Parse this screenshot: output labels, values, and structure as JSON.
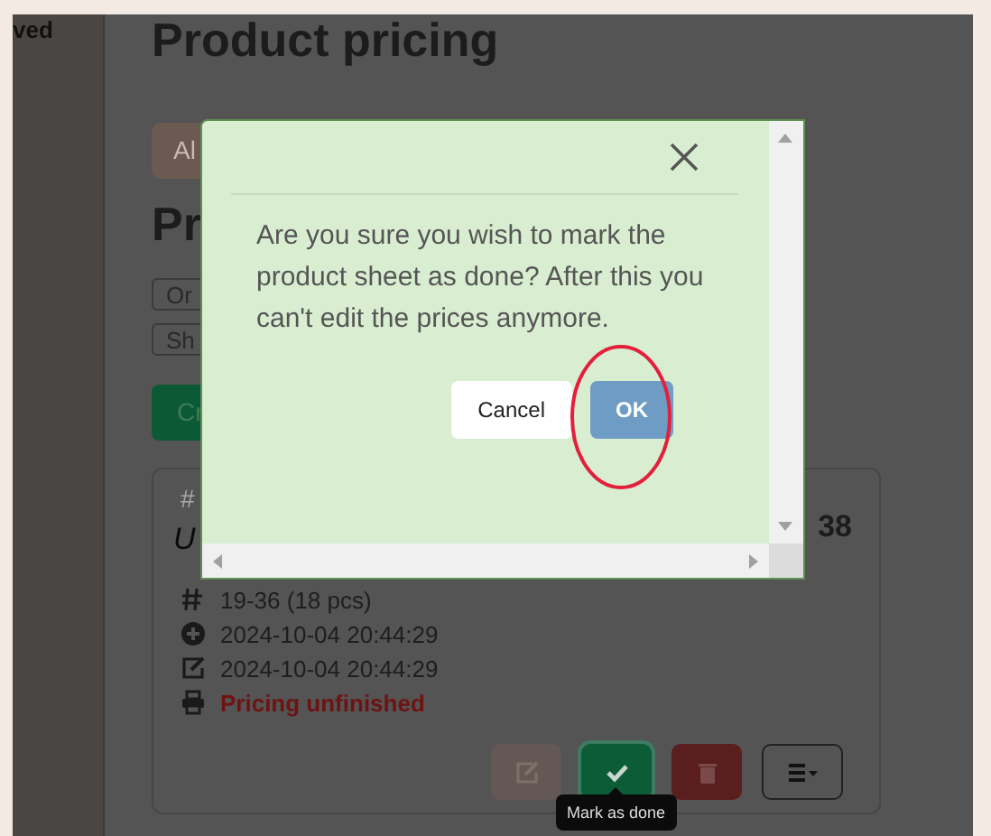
{
  "sidebar": {
    "label": "ved"
  },
  "page_title": "Product pricing",
  "top_button": {
    "label": "Al"
  },
  "section_title": "Pr",
  "outline_buttons": [
    "Or",
    "Sh"
  ],
  "create_button": {
    "label": "Cr"
  },
  "card": {
    "corner_mark": "#",
    "title": "U",
    "number": "38",
    "info_rows": [
      {
        "kind": "range",
        "text": "19-36 (18 pcs)"
      },
      {
        "kind": "created",
        "text": "2024-10-04 20:44:29"
      },
      {
        "kind": "edited",
        "text": "2024-10-04 20:44:29"
      },
      {
        "kind": "print",
        "text": "Pricing unfinished",
        "alert": true
      }
    ],
    "actions": [
      {
        "kind": "edit",
        "disabled": true
      },
      {
        "kind": "done",
        "disabled": false
      },
      {
        "kind": "delete",
        "disabled": false
      },
      {
        "kind": "menu",
        "disabled": false
      }
    ]
  },
  "tooltip": "Mark as done",
  "modal": {
    "message": "Are you sure you wish to mark the product sheet as done? After this you can't edit the prices anymore.",
    "buttons": [
      {
        "kind": "secondary",
        "label": "Cancel"
      },
      {
        "kind": "primary",
        "label": "OK"
      }
    ]
  }
}
